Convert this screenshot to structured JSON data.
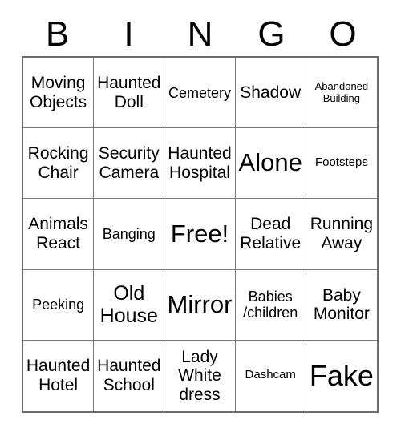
{
  "header": {
    "letters": [
      "B",
      "I",
      "N",
      "G",
      "O"
    ]
  },
  "grid": {
    "rows": 5,
    "columns": 5,
    "cells": [
      {
        "label": "Moving Objects",
        "size": "md"
      },
      {
        "label": "Haunted Doll",
        "size": "md"
      },
      {
        "label": "Cemetery",
        "size": "sm"
      },
      {
        "label": "Shadow",
        "size": "md"
      },
      {
        "label": "Abandoned Building",
        "size": "xxs"
      },
      {
        "label": "Rocking Chair",
        "size": "md"
      },
      {
        "label": "Security Camera",
        "size": "md"
      },
      {
        "label": "Haunted Hospital",
        "size": "md"
      },
      {
        "label": "Alone",
        "size": "xl"
      },
      {
        "label": "Footsteps",
        "size": "xs"
      },
      {
        "label": "Animals React",
        "size": "md"
      },
      {
        "label": "Banging",
        "size": "sm"
      },
      {
        "label": "Free!",
        "size": "xl"
      },
      {
        "label": "Dead Relative",
        "size": "md"
      },
      {
        "label": "Running Away",
        "size": "md"
      },
      {
        "label": "Peeking",
        "size": "sm"
      },
      {
        "label": "Old House",
        "size": "lg"
      },
      {
        "label": "Mirror",
        "size": "xl"
      },
      {
        "label": "Babies /children",
        "size": "sm"
      },
      {
        "label": "Baby Monitor",
        "size": "md"
      },
      {
        "label": "Haunted Hotel",
        "size": "md"
      },
      {
        "label": "Haunted School",
        "size": "md"
      },
      {
        "label": "Lady White dress",
        "size": "md"
      },
      {
        "label": "Dashcam",
        "size": "xs"
      },
      {
        "label": "Fake",
        "size": "xxl"
      }
    ]
  },
  "colors": {
    "background": "#ffffff",
    "text": "#000000",
    "gridline": "#7a7a7a",
    "outer_border": "#6b6b6b"
  }
}
